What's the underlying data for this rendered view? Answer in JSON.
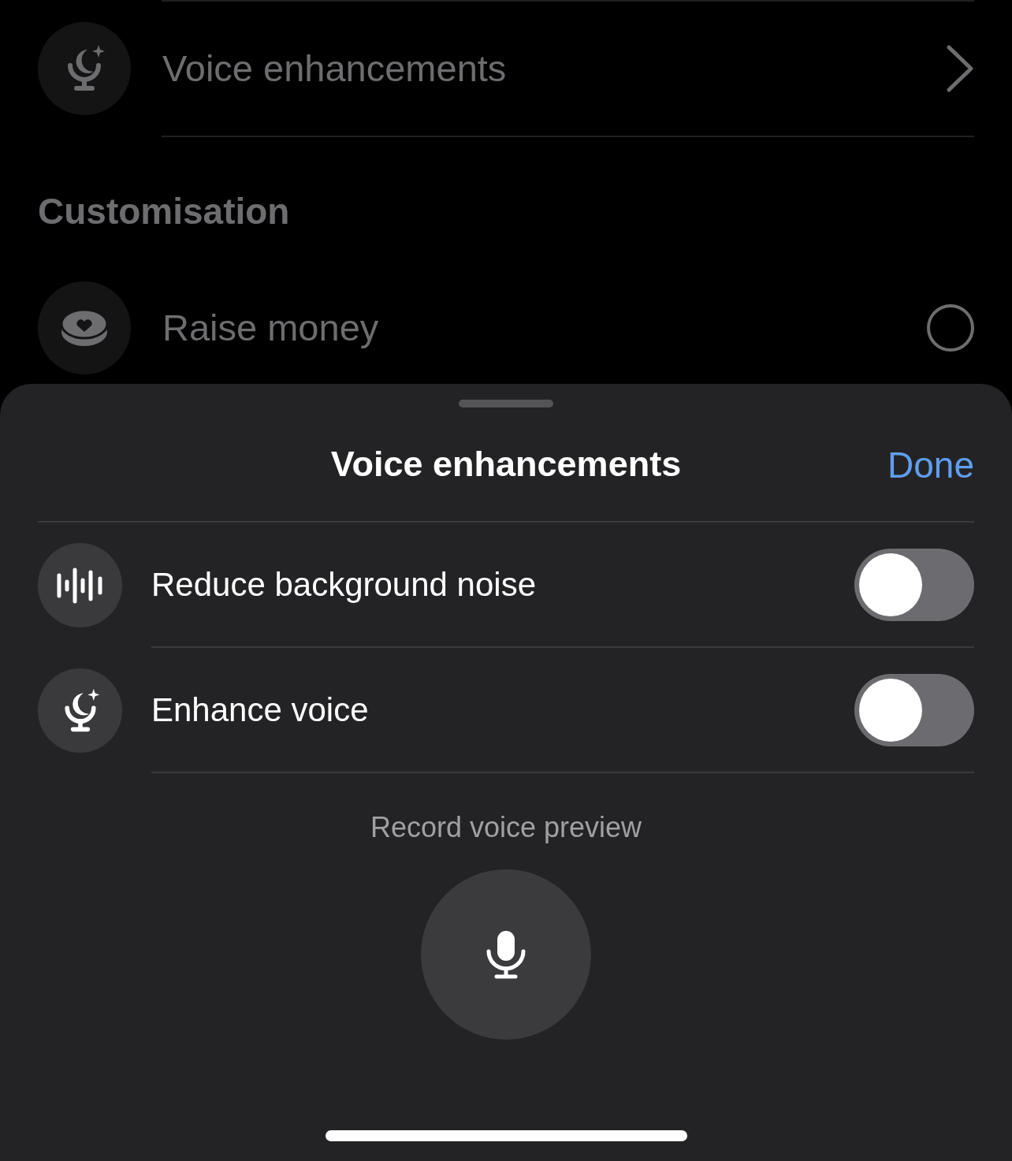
{
  "background_list": {
    "top_row": {
      "label": "Voice enhancements",
      "kind": "chevron"
    },
    "section_title": "Customisation",
    "rows": [
      {
        "label": "Raise money",
        "kind": "radio",
        "selected": false
      }
    ]
  },
  "sheet": {
    "title": "Voice enhancements",
    "done": "Done",
    "options": [
      {
        "label": "Reduce background noise",
        "kind": "noise",
        "on": false
      },
      {
        "label": "Enhance voice",
        "kind": "enhance",
        "on": false
      }
    ],
    "preview_label": "Record voice preview"
  }
}
